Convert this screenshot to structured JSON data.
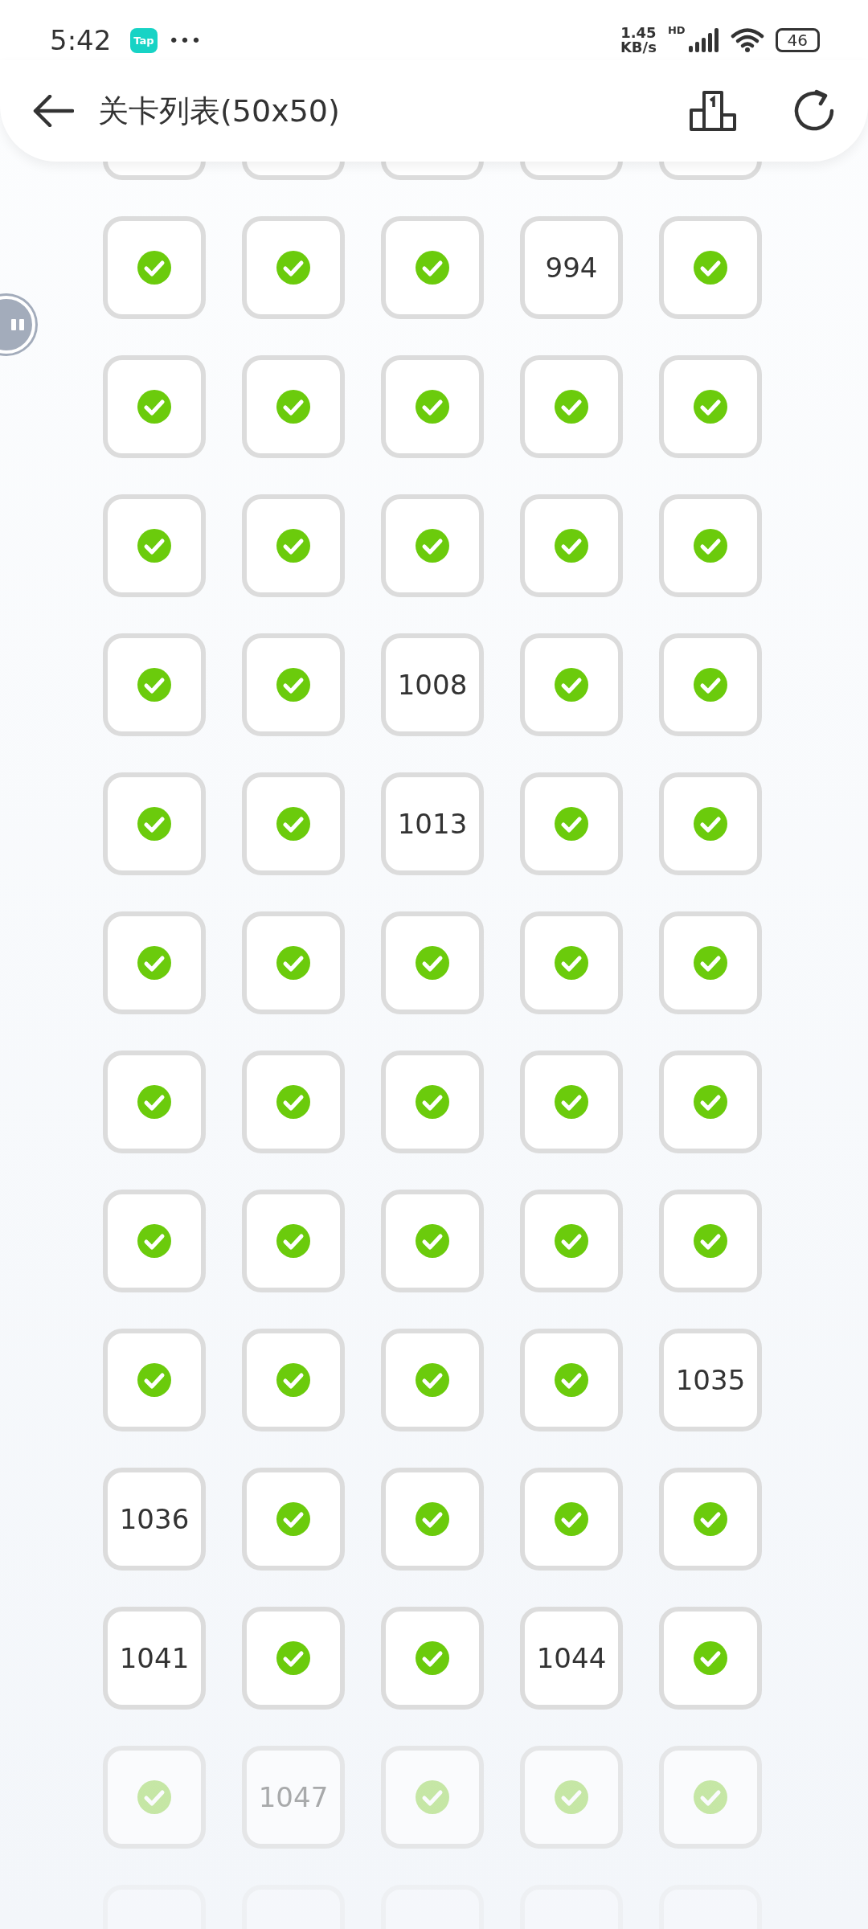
{
  "status_bar": {
    "time": "5:42",
    "app_badge": "Tap",
    "more": "•••",
    "speed_value": "1.45",
    "speed_unit": "KB/s",
    "network": "HD",
    "battery": "46"
  },
  "header": {
    "title": "关卡列表(50x50)"
  },
  "rows": [
    {
      "faded": false,
      "levels": [
        {
          "cleared": true
        },
        {
          "cleared": true
        },
        {
          "cleared": true
        },
        {
          "number": "994",
          "cleared": false
        },
        {
          "cleared": true
        }
      ]
    },
    {
      "faded": false,
      "levels": [
        {
          "cleared": true
        },
        {
          "cleared": true
        },
        {
          "cleared": true
        },
        {
          "cleared": true
        },
        {
          "cleared": true
        }
      ]
    },
    {
      "faded": false,
      "levels": [
        {
          "cleared": true
        },
        {
          "cleared": true
        },
        {
          "cleared": true
        },
        {
          "cleared": true
        },
        {
          "cleared": true
        }
      ]
    },
    {
      "faded": false,
      "levels": [
        {
          "cleared": true
        },
        {
          "cleared": true
        },
        {
          "number": "1008",
          "cleared": false
        },
        {
          "cleared": true
        },
        {
          "cleared": true
        }
      ]
    },
    {
      "faded": false,
      "levels": [
        {
          "cleared": true
        },
        {
          "cleared": true
        },
        {
          "number": "1013",
          "cleared": false
        },
        {
          "cleared": true
        },
        {
          "cleared": true
        }
      ]
    },
    {
      "faded": false,
      "levels": [
        {
          "cleared": true
        },
        {
          "cleared": true
        },
        {
          "cleared": true
        },
        {
          "cleared": true
        },
        {
          "cleared": true
        }
      ]
    },
    {
      "faded": false,
      "levels": [
        {
          "cleared": true
        },
        {
          "cleared": true
        },
        {
          "cleared": true
        },
        {
          "cleared": true
        },
        {
          "cleared": true
        }
      ]
    },
    {
      "faded": false,
      "levels": [
        {
          "cleared": true
        },
        {
          "cleared": true
        },
        {
          "cleared": true
        },
        {
          "cleared": true
        },
        {
          "cleared": true
        }
      ]
    },
    {
      "faded": false,
      "levels": [
        {
          "cleared": true
        },
        {
          "cleared": true
        },
        {
          "cleared": true
        },
        {
          "cleared": true
        },
        {
          "number": "1035",
          "cleared": false
        }
      ]
    },
    {
      "faded": false,
      "levels": [
        {
          "number": "1036",
          "cleared": false
        },
        {
          "cleared": true
        },
        {
          "cleared": true
        },
        {
          "cleared": true
        },
        {
          "cleared": true
        }
      ]
    },
    {
      "faded": false,
      "levels": [
        {
          "number": "1041",
          "cleared": false
        },
        {
          "cleared": true
        },
        {
          "cleared": true
        },
        {
          "number": "1044",
          "cleared": false
        },
        {
          "cleared": true
        }
      ]
    },
    {
      "faded": true,
      "levels": [
        {
          "cleared": true
        },
        {
          "number": "1047",
          "cleared": false
        },
        {
          "cleared": true
        },
        {
          "cleared": true
        },
        {
          "cleared": true
        }
      ]
    }
  ]
}
